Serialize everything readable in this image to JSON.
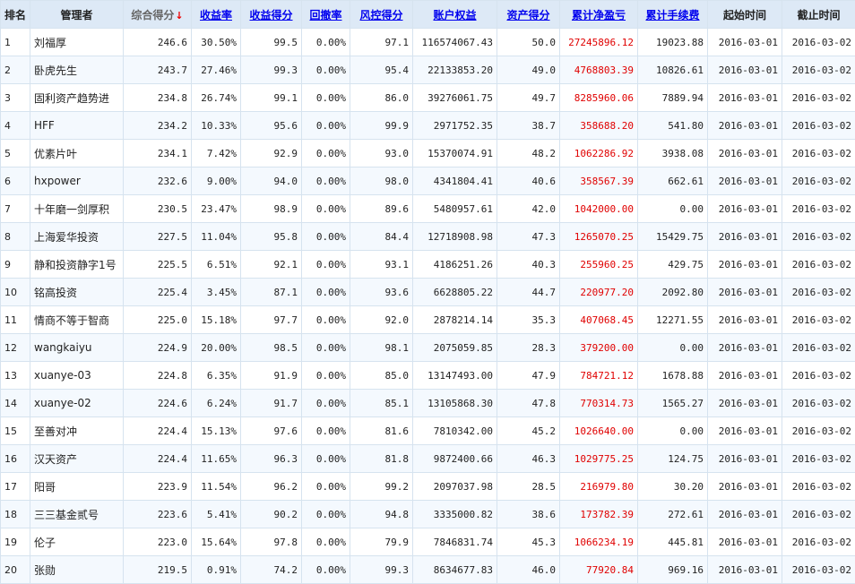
{
  "headers": {
    "rank": "排名",
    "manager": "管理者",
    "total_score": "综合得分",
    "total_score_arrow": "↓",
    "return_rate": "收益率",
    "return_score": "收益得分",
    "drawdown": "回撤率",
    "risk_score": "风控得分",
    "equity": "账户权益",
    "asset_score": "资产得分",
    "cum_pnl": "累计净盈亏",
    "cum_fee": "累计手续费",
    "start": "起始时间",
    "end": "截止时间"
  },
  "colors": {
    "header_bg": "#dde9f6",
    "link": "#0000ee",
    "pnl": "#e00000",
    "row_alt": "#f4f9fe"
  },
  "rows": [
    {
      "rank": "1",
      "manager": "刘福厚",
      "total_score": "246.6",
      "return_rate": "30.50%",
      "return_score": "99.5",
      "drawdown": "0.00%",
      "risk_score": "97.1",
      "equity": "116574067.43",
      "asset_score": "50.0",
      "cum_pnl": "27245896.12",
      "cum_fee": "19023.88",
      "start": "2016-03-01",
      "end": "2016-03-02"
    },
    {
      "rank": "2",
      "manager": "卧虎先生",
      "total_score": "243.7",
      "return_rate": "27.46%",
      "return_score": "99.3",
      "drawdown": "0.00%",
      "risk_score": "95.4",
      "equity": "22133853.20",
      "asset_score": "49.0",
      "cum_pnl": "4768803.39",
      "cum_fee": "10826.61",
      "start": "2016-03-01",
      "end": "2016-03-02"
    },
    {
      "rank": "3",
      "manager": "固利资产趋势进",
      "total_score": "234.8",
      "return_rate": "26.74%",
      "return_score": "99.1",
      "drawdown": "0.00%",
      "risk_score": "86.0",
      "equity": "39276061.75",
      "asset_score": "49.7",
      "cum_pnl": "8285960.06",
      "cum_fee": "7889.94",
      "start": "2016-03-01",
      "end": "2016-03-02"
    },
    {
      "rank": "4",
      "manager": "HFF",
      "total_score": "234.2",
      "return_rate": "10.33%",
      "return_score": "95.6",
      "drawdown": "0.00%",
      "risk_score": "99.9",
      "equity": "2971752.35",
      "asset_score": "38.7",
      "cum_pnl": "358688.20",
      "cum_fee": "541.80",
      "start": "2016-03-01",
      "end": "2016-03-02"
    },
    {
      "rank": "5",
      "manager": "优素片叶",
      "total_score": "234.1",
      "return_rate": "7.42%",
      "return_score": "92.9",
      "drawdown": "0.00%",
      "risk_score": "93.0",
      "equity": "15370074.91",
      "asset_score": "48.2",
      "cum_pnl": "1062286.92",
      "cum_fee": "3938.08",
      "start": "2016-03-01",
      "end": "2016-03-02"
    },
    {
      "rank": "6",
      "manager": "hxpower",
      "total_score": "232.6",
      "return_rate": "9.00%",
      "return_score": "94.0",
      "drawdown": "0.00%",
      "risk_score": "98.0",
      "equity": "4341804.41",
      "asset_score": "40.6",
      "cum_pnl": "358567.39",
      "cum_fee": "662.61",
      "start": "2016-03-01",
      "end": "2016-03-02"
    },
    {
      "rank": "7",
      "manager": "十年磨一剑厚积",
      "total_score": "230.5",
      "return_rate": "23.47%",
      "return_score": "98.9",
      "drawdown": "0.00%",
      "risk_score": "89.6",
      "equity": "5480957.61",
      "asset_score": "42.0",
      "cum_pnl": "1042000.00",
      "cum_fee": "0.00",
      "start": "2016-03-01",
      "end": "2016-03-02"
    },
    {
      "rank": "8",
      "manager": "上海爱华投资",
      "total_score": "227.5",
      "return_rate": "11.04%",
      "return_score": "95.8",
      "drawdown": "0.00%",
      "risk_score": "84.4",
      "equity": "12718908.98",
      "asset_score": "47.3",
      "cum_pnl": "1265070.25",
      "cum_fee": "15429.75",
      "start": "2016-03-01",
      "end": "2016-03-02"
    },
    {
      "rank": "9",
      "manager": "静和投资静字1号",
      "total_score": "225.5",
      "return_rate": "6.51%",
      "return_score": "92.1",
      "drawdown": "0.00%",
      "risk_score": "93.1",
      "equity": "4186251.26",
      "asset_score": "40.3",
      "cum_pnl": "255960.25",
      "cum_fee": "429.75",
      "start": "2016-03-01",
      "end": "2016-03-02"
    },
    {
      "rank": "10",
      "manager": "铭高投资",
      "total_score": "225.4",
      "return_rate": "3.45%",
      "return_score": "87.1",
      "drawdown": "0.00%",
      "risk_score": "93.6",
      "equity": "6628805.22",
      "asset_score": "44.7",
      "cum_pnl": "220977.20",
      "cum_fee": "2092.80",
      "start": "2016-03-01",
      "end": "2016-03-02"
    },
    {
      "rank": "11",
      "manager": "情商不等于智商",
      "total_score": "225.0",
      "return_rate": "15.18%",
      "return_score": "97.7",
      "drawdown": "0.00%",
      "risk_score": "92.0",
      "equity": "2878214.14",
      "asset_score": "35.3",
      "cum_pnl": "407068.45",
      "cum_fee": "12271.55",
      "start": "2016-03-01",
      "end": "2016-03-02"
    },
    {
      "rank": "12",
      "manager": "wangkaiyu",
      "total_score": "224.9",
      "return_rate": "20.00%",
      "return_score": "98.5",
      "drawdown": "0.00%",
      "risk_score": "98.1",
      "equity": "2075059.85",
      "asset_score": "28.3",
      "cum_pnl": "379200.00",
      "cum_fee": "0.00",
      "start": "2016-03-01",
      "end": "2016-03-02"
    },
    {
      "rank": "13",
      "manager": "xuanye-03",
      "total_score": "224.8",
      "return_rate": "6.35%",
      "return_score": "91.9",
      "drawdown": "0.00%",
      "risk_score": "85.0",
      "equity": "13147493.00",
      "asset_score": "47.9",
      "cum_pnl": "784721.12",
      "cum_fee": "1678.88",
      "start": "2016-03-01",
      "end": "2016-03-02"
    },
    {
      "rank": "14",
      "manager": "xuanye-02",
      "total_score": "224.6",
      "return_rate": "6.24%",
      "return_score": "91.7",
      "drawdown": "0.00%",
      "risk_score": "85.1",
      "equity": "13105868.30",
      "asset_score": "47.8",
      "cum_pnl": "770314.73",
      "cum_fee": "1565.27",
      "start": "2016-03-01",
      "end": "2016-03-02"
    },
    {
      "rank": "15",
      "manager": "至善对冲",
      "total_score": "224.4",
      "return_rate": "15.13%",
      "return_score": "97.6",
      "drawdown": "0.00%",
      "risk_score": "81.6",
      "equity": "7810342.00",
      "asset_score": "45.2",
      "cum_pnl": "1026640.00",
      "cum_fee": "0.00",
      "start": "2016-03-01",
      "end": "2016-03-02"
    },
    {
      "rank": "16",
      "manager": "汉天资产",
      "total_score": "224.4",
      "return_rate": "11.65%",
      "return_score": "96.3",
      "drawdown": "0.00%",
      "risk_score": "81.8",
      "equity": "9872400.66",
      "asset_score": "46.3",
      "cum_pnl": "1029775.25",
      "cum_fee": "124.75",
      "start": "2016-03-01",
      "end": "2016-03-02"
    },
    {
      "rank": "17",
      "manager": "阳哥",
      "total_score": "223.9",
      "return_rate": "11.54%",
      "return_score": "96.2",
      "drawdown": "0.00%",
      "risk_score": "99.2",
      "equity": "2097037.98",
      "asset_score": "28.5",
      "cum_pnl": "216979.80",
      "cum_fee": "30.20",
      "start": "2016-03-01",
      "end": "2016-03-02"
    },
    {
      "rank": "18",
      "manager": "三三基金贰号",
      "total_score": "223.6",
      "return_rate": "5.41%",
      "return_score": "90.2",
      "drawdown": "0.00%",
      "risk_score": "94.8",
      "equity": "3335000.82",
      "asset_score": "38.6",
      "cum_pnl": "173782.39",
      "cum_fee": "272.61",
      "start": "2016-03-01",
      "end": "2016-03-02"
    },
    {
      "rank": "19",
      "manager": "伦子",
      "total_score": "223.0",
      "return_rate": "15.64%",
      "return_score": "97.8",
      "drawdown": "0.00%",
      "risk_score": "79.9",
      "equity": "7846831.74",
      "asset_score": "45.3",
      "cum_pnl": "1066234.19",
      "cum_fee": "445.81",
      "start": "2016-03-01",
      "end": "2016-03-02"
    },
    {
      "rank": "20",
      "manager": "张勋",
      "total_score": "219.5",
      "return_rate": "0.91%",
      "return_score": "74.2",
      "drawdown": "0.00%",
      "risk_score": "99.3",
      "equity": "8634677.83",
      "asset_score": "46.0",
      "cum_pnl": "77920.84",
      "cum_fee": "969.16",
      "start": "2016-03-01",
      "end": "2016-03-02"
    }
  ]
}
